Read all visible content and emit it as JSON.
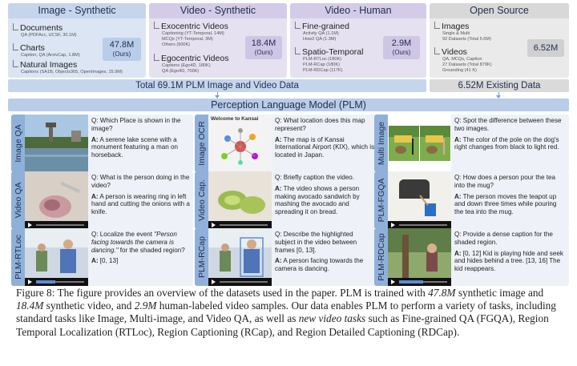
{
  "columns": [
    {
      "title": "Image - Synthetic",
      "color": "#dbe5f3",
      "hdr": "#c5d5ec",
      "groups": [
        {
          "name": "Documents",
          "sub": "QA (PDFAcc, UCSF, 30.1M)"
        },
        {
          "name": "Charts",
          "sub": "Caption, QA (ArxivCap, 1.8M)"
        },
        {
          "name": "Natural Images",
          "sub": "Captions (SA1B, Objects365, OpenImages, 15.9M)"
        }
      ],
      "count": "47.8M",
      "ours": "(Ours)"
    },
    {
      "title": "Video - Synthetic",
      "color": "#e6e1f1",
      "hdr": "#d3cbe8",
      "groups": [
        {
          "name": "Exocentric Videos",
          "subs": [
            "Captioning (YT-Temporal, 14M)",
            "MCQs (YT-Temporal, 3M)",
            "Others (500K)"
          ]
        },
        {
          "name": "Egocentric Videos",
          "subs": [
            "Captions (Ego4D, 180K)",
            "QA (Ego4D, 700K)"
          ]
        }
      ],
      "count": "18.4M",
      "ours": "(Ours)"
    },
    {
      "title": "Video - Human",
      "color": "#e6e1f1",
      "hdr": "#d3cbe8",
      "groups": [
        {
          "name": "Fine-grained",
          "subs": [
            "Activity QA (1.1M)",
            "How2 QA (1.3M)"
          ]
        },
        {
          "name": "Spatio-Temporal",
          "subs": [
            "PLM-RTLoc (180K)",
            "PLM-RCap (180K)",
            "PLM-RDCap (117K)"
          ]
        }
      ],
      "count": "2.9M",
      "ours": "(Ours)"
    },
    {
      "title": "Open Source",
      "color": "#eaeaea",
      "hdr": "#d8d8d8",
      "groups": [
        {
          "name": "Images",
          "subs": [
            "Single & Multi",
            "92 Datasets (Total 5.6M)"
          ]
        },
        {
          "name": "Videos",
          "subs": [
            "QA, MCQs, Caption",
            "27 Datasets (Total 879K)",
            "Grounding (41 K)"
          ]
        }
      ],
      "count": "6.52M"
    }
  ],
  "totals": {
    "plm": "Total 69.1M PLM Image and Video Data",
    "existing": "6.52M Existing Data"
  },
  "model_title": "Perception Language Model (PLM)",
  "tasks": [
    {
      "tag": "Image QA",
      "q": "Q: Which Place is shown in the image?",
      "a": "A serene lake scene with a monument featuring a man on horseback."
    },
    {
      "tag": "Image OCR",
      "q": "Q: What location does this map represent?",
      "a": "The map is of Kansai International Airport (KIX), which is located in Japan.",
      "img_text": "Welcome to Kansai"
    },
    {
      "tag": "Multi Image",
      "q": "Q: Spot the difference between these two images.",
      "a": "The color of the pole on the dog's right changes from black to light red."
    },
    {
      "tag": "Video QA",
      "q": "Q: What is the person doing in the video?",
      "a": "A person is wearing ring in left hand and cutting the onions with a knife."
    },
    {
      "tag": "Video Cap.",
      "q": "Q: Briefly caption the video.",
      "a": "The video shows a person making avocado sandwich by mashing the avocado and spreading it on bread."
    },
    {
      "tag": "PLM-FGQA",
      "q": "Q: How does a person pour the tea into the mug?",
      "a": "The person moves the teapot up and down three times while pouring the tea into the mug."
    },
    {
      "tag": "PLM-RTLoc",
      "q": "Q: Localize the event",
      "q_quote": "\"Person facing towards the camera is dancing.\"",
      "q_end": "for the shaded region?",
      "a": "[0, 13]"
    },
    {
      "tag": "PLM-RCap",
      "q": "Q: Describe the highlighted subject in the video between frames [0, 13].",
      "a": "A person facing towards the camera is dancing."
    },
    {
      "tag": "PLM-RDCap",
      "q": "Q: Provide a dense caption for the shaded region.",
      "a": "[0, 12] Kid is playing hide and seek and hides behind a tree. [13, 16] The kid reappears."
    }
  ],
  "answer_prefix": "A:",
  "caption": {
    "p1": "Figure 8: The figure provides an overview of the datasets used in the paper. PLM is trained with ",
    "i1": "47.8M",
    "p2": " synthetic image and ",
    "i2": "18.4M",
    "p3": " synthetic video, and ",
    "i3": "2.9M",
    "p4": " human-labeled video samples. Our data enables PLM to perform a variety of tasks, including standard tasks like Image, Multi-image, and Video QA, as well as ",
    "i4": "new video tasks",
    "p5": " such as Fine-grained QA (FGQA), Region Temporal Localization (RTLoc), Region Captioning (RCap), and Region Detailed Captioning (RDCap)."
  }
}
